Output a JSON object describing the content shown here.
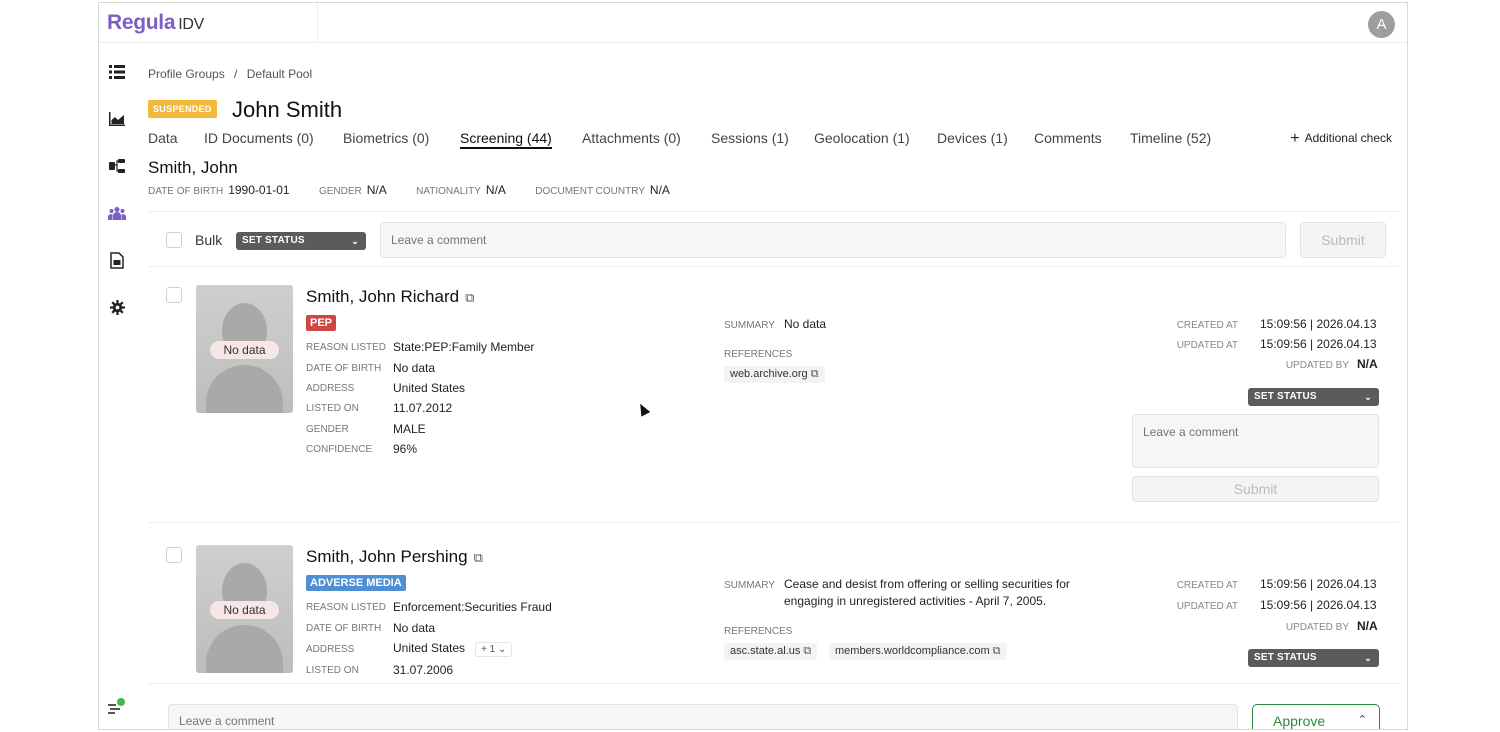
{
  "brand": {
    "name": "Regula",
    "product": "IDV"
  },
  "user": {
    "avatar_initial": "A"
  },
  "sidebar": {
    "icons": [
      "list-icon",
      "chart-icon",
      "workflow-icon",
      "users-icon",
      "document-icon",
      "gear-icon",
      "status-icon"
    ]
  },
  "breadcrumb": {
    "items": [
      "Profile Groups",
      "/",
      "Default Pool"
    ]
  },
  "profile": {
    "status_badge": "SUSPENDED",
    "name": "John Smith"
  },
  "tabs": [
    {
      "label": "Data"
    },
    {
      "label": "ID Documents (0)"
    },
    {
      "label": "Biometrics (0)"
    },
    {
      "label": "Screening (44)",
      "active": true
    },
    {
      "label": "Attachments (0)"
    },
    {
      "label": "Sessions (1)"
    },
    {
      "label": "Geolocation (1)"
    },
    {
      "label": "Devices (1)"
    },
    {
      "label": "Comments"
    },
    {
      "label": "Timeline (52)"
    }
  ],
  "additional_check": {
    "label": "Additional check"
  },
  "subject": {
    "name": "Smith, John",
    "dob_label": "DATE OF BIRTH",
    "dob": "1990-01-01",
    "gender_label": "GENDER",
    "gender": "N/A",
    "nationality_label": "NATIONALITY",
    "nationality": "N/A",
    "doc_country_label": "DOCUMENT COUNTRY",
    "doc_country": "N/A"
  },
  "bulk": {
    "label": "Bulk",
    "set_status": "SET STATUS",
    "comment_placeholder": "Leave a comment",
    "submit": "Submit"
  },
  "matches": [
    {
      "name": "Smith, John Richard",
      "photo_text": "No data",
      "badge": "PEP",
      "fields": [
        {
          "label": "REASON LISTED",
          "value": "State:PEP:Family Member"
        },
        {
          "label": "DATE OF BIRTH",
          "value": "No data"
        },
        {
          "label": "ADDRESS",
          "value": "United States"
        },
        {
          "label": "LISTED ON",
          "value": "11.07.2012"
        },
        {
          "label": "GENDER",
          "value": "MALE"
        },
        {
          "label": "CONFIDENCE",
          "value": "96%"
        }
      ],
      "summary_label": "SUMMARY",
      "summary": "No data",
      "references_label": "REFERENCES",
      "references": [
        "web.archive.org"
      ],
      "created_label": "CREATED AT",
      "created": "15:09:56 | 2026.04.13",
      "updated_label": "UPDATED AT",
      "updated": "15:09:56 | 2026.04.13",
      "updated_by_label": "UPDATED BY",
      "updated_by": "N/A",
      "set_status": "SET STATUS",
      "comment_placeholder": "Leave a comment",
      "submit": "Submit"
    },
    {
      "name": "Smith, John Pershing",
      "photo_text": "No data",
      "badge": "ADVERSE MEDIA",
      "fields": [
        {
          "label": "REASON LISTED",
          "value": "Enforcement:Securities Fraud"
        },
        {
          "label": "DATE OF BIRTH",
          "value": "No data"
        },
        {
          "label": "ADDRESS",
          "value": "United States"
        },
        {
          "label": "LISTED ON",
          "value": "31.07.2006"
        }
      ],
      "address_more": "+ 1",
      "summary_label": "SUMMARY",
      "summary_line1": "Cease and desist from offering or selling securities for",
      "summary_line2": "engaging in unregistered activities - April 7, 2005.",
      "references_label": "REFERENCES",
      "references": [
        "asc.state.al.us",
        "members.worldcompliance.com"
      ],
      "created_label": "CREATED AT",
      "created": "15:09:56 | 2026.04.13",
      "updated_label": "UPDATED AT",
      "updated": "15:09:56 | 2026.04.13",
      "updated_by_label": "UPDATED BY",
      "updated_by": "N/A",
      "set_status": "SET STATUS"
    }
  ],
  "footer": {
    "comment_placeholder": "Leave a comment",
    "approve": "Approve"
  }
}
